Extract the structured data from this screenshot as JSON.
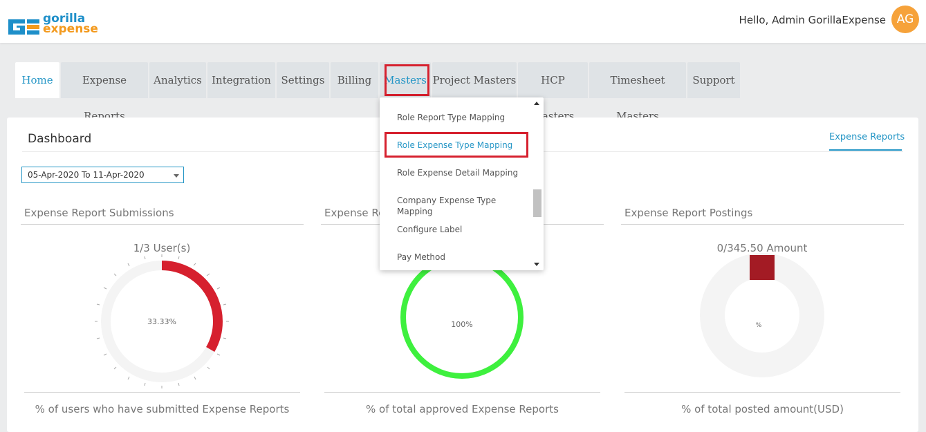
{
  "header": {
    "logo_line1": "gorilla",
    "logo_line2": "expense",
    "greeting": "Hello, Admin GorillaExpense",
    "avatar_initials": "AG"
  },
  "tabs": [
    "Home",
    "Expense Reports",
    "Analytics",
    "Integration",
    "Settings",
    "Billing",
    "Masters",
    "Project Masters",
    "HCP Masters",
    "Timesheet Masters",
    "Support"
  ],
  "active_tab": "Home",
  "dashboard": {
    "title": "Dashboard",
    "link": "Expense Reports",
    "date_range": "05-Apr-2020 To 11-Apr-2020"
  },
  "masters_menu": {
    "items": [
      "Role Report Type Mapping",
      "Role Expense Type Mapping",
      "Role Expense Detail Mapping",
      "Company Expense Type Mapping",
      "Configure Label",
      "Pay Method"
    ],
    "highlighted": "Role Expense Type Mapping"
  },
  "panels": [
    {
      "title": "Expense Report Submissions",
      "caption": "1/3 User(s)",
      "center_label": "33.33%",
      "percent": 33.33,
      "color": "#d6202e",
      "footer": "% of users who have submitted Expense Reports"
    },
    {
      "title": "Expense Re",
      "caption": "",
      "center_label": "100%",
      "percent": 100,
      "color": "#3ef03e",
      "footer": "% of total approved Expense Reports"
    },
    {
      "title": "Expense Report Postings",
      "caption": "0/345.50 Amount",
      "center_label": "%",
      "percent": 0,
      "color": "#a31b24",
      "footer": "% of total posted amount(USD)"
    }
  ],
  "colors": {
    "accent": "#2596c6",
    "highlight_box": "#d6202e",
    "avatar": "#f6a23a"
  }
}
